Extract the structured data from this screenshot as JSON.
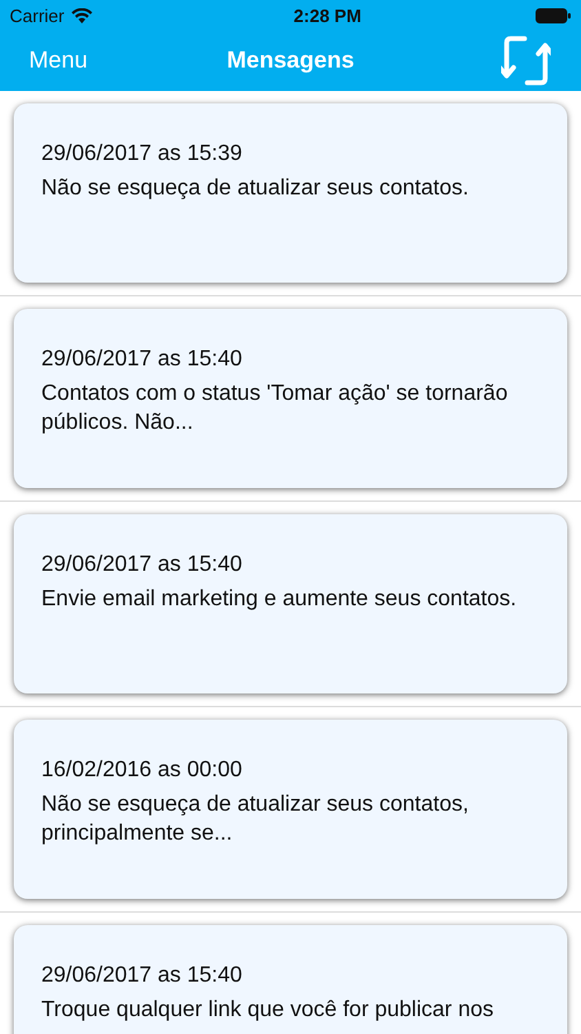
{
  "status_bar": {
    "carrier": "Carrier",
    "time": "2:28 PM"
  },
  "nav_bar": {
    "left": "Menu",
    "title": "Mensagens"
  },
  "messages": [
    {
      "date": "29/06/2017 as 15:39",
      "text": "Não se esqueça de atualizar seus contatos."
    },
    {
      "date": "29/06/2017 as 15:40",
      "text": "Contatos com o status 'Tomar ação' se tornarão públicos. Não..."
    },
    {
      "date": "29/06/2017 as 15:40",
      "text": "Envie email marketing e aumente seus contatos."
    },
    {
      "date": "16/02/2016 as 00:00",
      "text": "Não se esqueça de atualizar seus contatos, principalmente se..."
    },
    {
      "date": "29/06/2017 as 15:40",
      "text": "Troque qualquer link que você for publicar nos"
    }
  ]
}
